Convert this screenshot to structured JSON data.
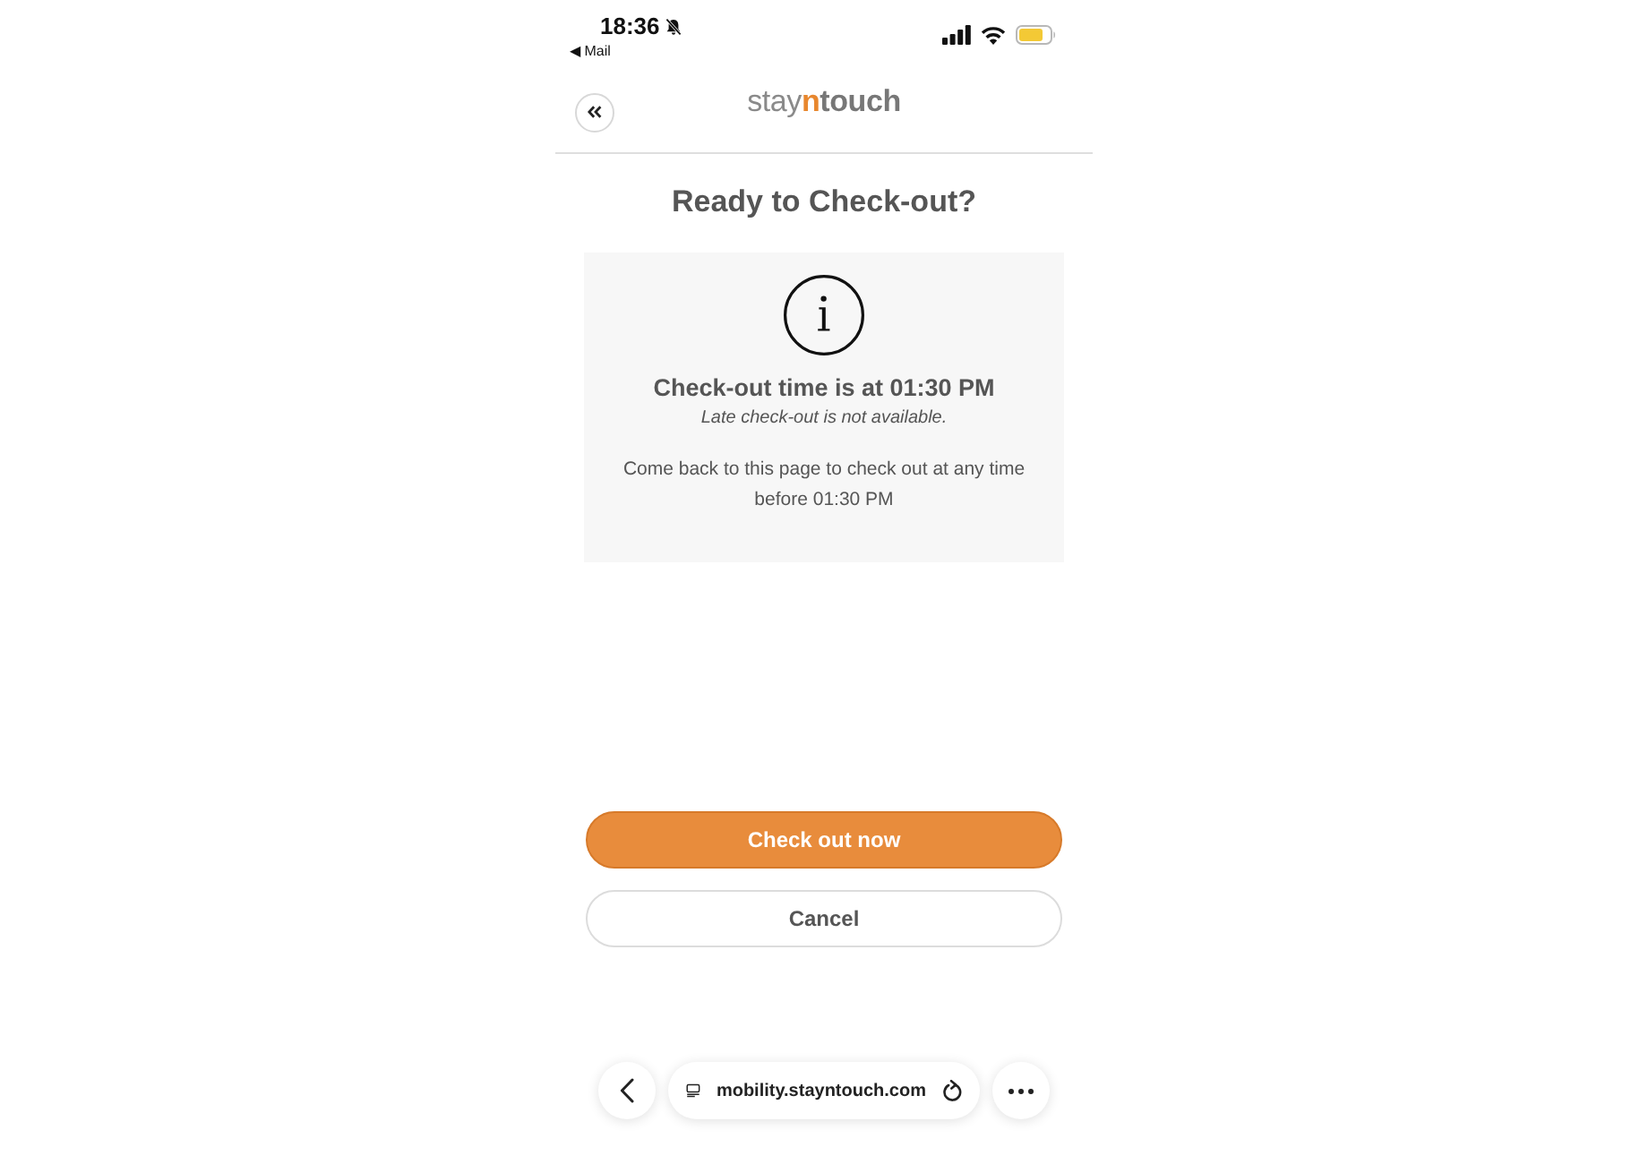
{
  "status_bar": {
    "time": "18:36",
    "back_link": "◀ Mail"
  },
  "header": {
    "logo": [
      {
        "text": "stay",
        "kind": "light"
      },
      {
        "text": "n",
        "kind": "accent"
      },
      {
        "text": "touch",
        "kind": "bold"
      }
    ]
  },
  "title": "Ready to Check-out?",
  "info_card": {
    "heading": "Check-out time is at 01:30 PM",
    "note": "Late check-out is not available.",
    "message": "Come back to this page to check out at any time before 01:30 PM"
  },
  "buttons": [
    {
      "label": "Check out now",
      "kind": "primary"
    },
    {
      "label": "Cancel",
      "kind": "secondary"
    }
  ],
  "browser_bar": {
    "url": "mobility.stayntouch.com"
  }
}
